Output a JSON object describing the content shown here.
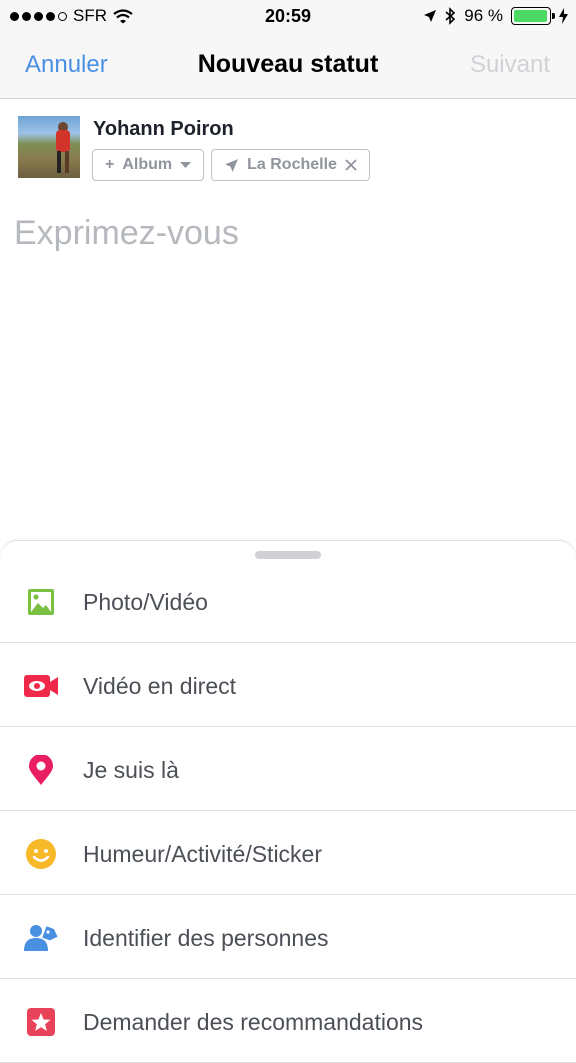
{
  "status_bar": {
    "carrier": "SFR",
    "time": "20:59",
    "battery": "96 %",
    "battery_level": 0.96
  },
  "nav": {
    "cancel": "Annuler",
    "title": "Nouveau statut",
    "next": "Suivant"
  },
  "composer": {
    "user_name": "Yohann Poiron",
    "album_chip": "Album",
    "location_chip": "La Rochelle",
    "placeholder": "Exprimez-vous"
  },
  "menu": {
    "items": [
      {
        "label": "Photo/Vidéo",
        "icon": "photo-icon",
        "color": "#7ac143"
      },
      {
        "label": "Vidéo en direct",
        "icon": "live-video-icon",
        "color": "#f02849"
      },
      {
        "label": "Je suis là",
        "icon": "location-pin-icon",
        "color": "#e91e63"
      },
      {
        "label": "Humeur/Activité/Sticker",
        "icon": "smiley-icon",
        "color": "#f7b928"
      },
      {
        "label": "Identifier des personnes",
        "icon": "tag-people-icon",
        "color": "#4a90e2"
      },
      {
        "label": "Demander des recommandations",
        "icon": "star-badge-icon",
        "color": "#e8435a"
      }
    ]
  }
}
